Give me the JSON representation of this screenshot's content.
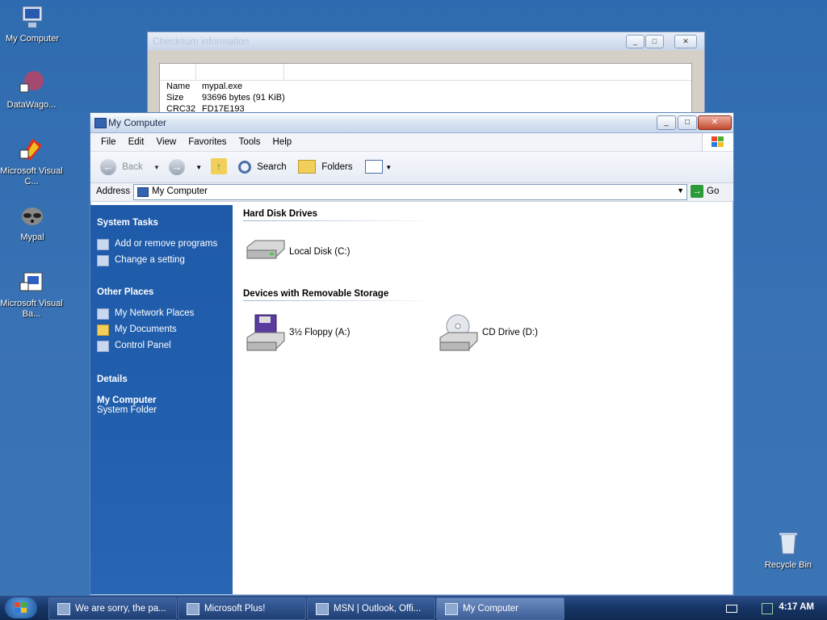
{
  "desktop": {
    "icons": [
      {
        "label": "My Computer",
        "icon": "my-computer-icon"
      },
      {
        "label": "DataWago...",
        "icon": "datawago-shortcut-icon"
      },
      {
        "label": "Microsoft Visual C...",
        "icon": "visual-c-shortcut-icon"
      },
      {
        "label": "Mypal",
        "icon": "mypal-raccoon-icon"
      },
      {
        "label": "Microsoft Visual Ba...",
        "icon": "visual-basic-shortcut-icon"
      },
      {
        "label": "Recycle Bin",
        "icon": "recycle-bin-icon"
      }
    ]
  },
  "checksum_window": {
    "title": "Checksum information",
    "rows": [
      {
        "key": "Name",
        "value": "mypal.exe"
      },
      {
        "key": "Size",
        "value": "93696 bytes (91 KiB)"
      },
      {
        "key": "CRC32",
        "value": "FD17E193"
      }
    ]
  },
  "window": {
    "title": "My Computer",
    "menu": [
      "File",
      "Edit",
      "View",
      "Favorites",
      "Tools",
      "Help"
    ],
    "toolbar": {
      "back": "Back",
      "search": "Search",
      "folders": "Folders"
    },
    "address": {
      "label": "Address",
      "value": "My Computer",
      "go": "Go"
    },
    "sidebar": {
      "system_tasks": {
        "title": "System Tasks",
        "items": [
          "Add or remove programs",
          "Change a setting"
        ]
      },
      "other_places": {
        "title": "Other Places",
        "items": [
          "My Network Places",
          "My Documents",
          "Control Panel"
        ]
      },
      "details": {
        "title": "Details",
        "name": "My Computer",
        "type": "System Folder"
      }
    },
    "groups": [
      {
        "title": "Hard Disk Drives",
        "items": [
          {
            "label": "Local Disk (C:)",
            "icon": "hard-disk-icon"
          }
        ]
      },
      {
        "title": "Devices with Removable Storage",
        "items": [
          {
            "label": "3½ Floppy (A:)",
            "icon": "floppy-drive-icon"
          },
          {
            "label": "CD Drive (D:)",
            "icon": "cd-drive-icon"
          }
        ]
      }
    ]
  },
  "taskbar": {
    "tasks": [
      {
        "label": "We are sorry, the pa...",
        "active": false
      },
      {
        "label": "Microsoft Plus!",
        "active": false
      },
      {
        "label": "MSN | Outlook, Offi...",
        "active": false
      },
      {
        "label": "My Computer",
        "active": true
      }
    ],
    "clock": "4:17 AM"
  }
}
